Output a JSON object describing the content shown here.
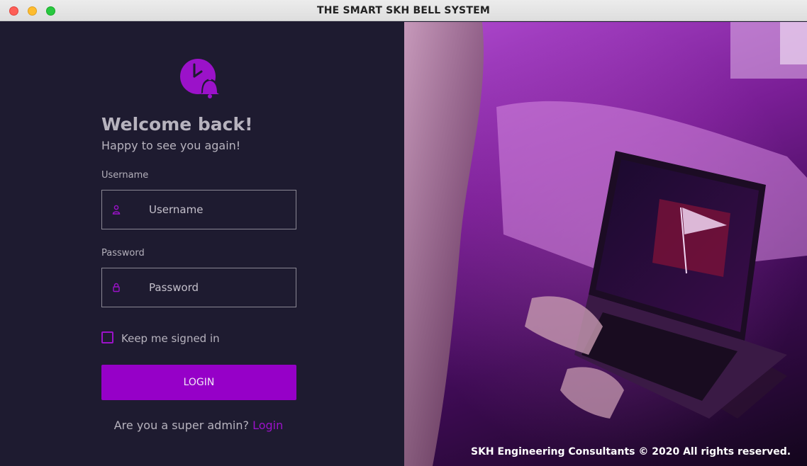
{
  "window": {
    "title": "THE SMART SKH BELL SYSTEM"
  },
  "login": {
    "logo_icon": "clock-bell-icon",
    "heading": "Welcome back!",
    "subheading": "Happy to see you again!",
    "username": {
      "label": "Username",
      "placeholder": "Username",
      "value": "",
      "icon": "user-icon"
    },
    "password": {
      "label": "Password",
      "placeholder": "Password",
      "value": "",
      "icon": "lock-icon"
    },
    "keep_signed_in": {
      "label": "Keep me signed in",
      "checked": false
    },
    "login_button": "LOGIN",
    "super_admin_prompt": "Are you a super admin?",
    "super_admin_link": "Login"
  },
  "hero": {
    "description": "person-using-laptop-on-bed",
    "footer": "SKH Engineering Consultants © 2020 All rights reserved."
  },
  "colors": {
    "accent": "#9600c8",
    "panel_bg": "#1e1b30",
    "text": "#b7b3be"
  }
}
